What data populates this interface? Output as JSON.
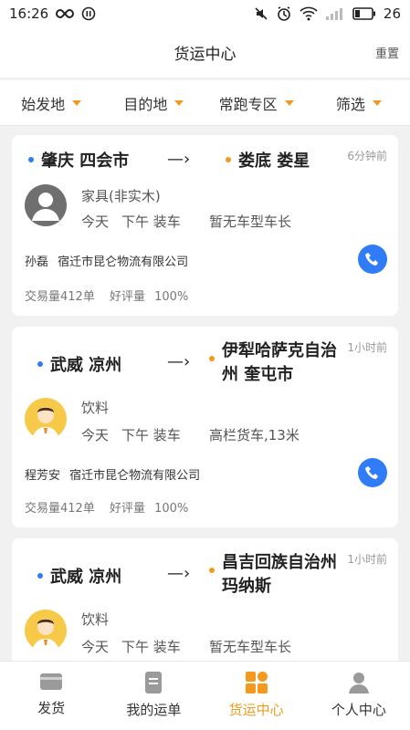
{
  "status_bar": {
    "time": "16:26",
    "battery": "26"
  },
  "header": {
    "title": "货运中心",
    "reset_label": "重置"
  },
  "filters": [
    {
      "label": "始发地"
    },
    {
      "label": "目的地"
    },
    {
      "label": "常跑专区"
    },
    {
      "label": "筛选"
    }
  ],
  "colors": {
    "accent": "#f39a1e",
    "blue": "#2f7cf6"
  },
  "cards": [
    {
      "from": "肇庆 四会市",
      "to": "娄底 娄星",
      "time_ago": "6分钟前",
      "goods": "家具(非实木)",
      "day": "今天",
      "period": "下午 装车",
      "truck": "暂无车型车长",
      "contact": "孙磊",
      "company": "宿迁市昆仑物流有限公司",
      "trades": "交易量412单",
      "rating_label": "好评量",
      "rating": "100%",
      "avatar": "default-avatar-icon"
    },
    {
      "from": "武威 凉州",
      "to": "伊犁哈萨克自治州 奎屯市",
      "time_ago": "1小时前",
      "goods": "饮料",
      "day": "今天",
      "period": "下午 装车",
      "truck": "高栏货车,13米",
      "contact": "程芳安",
      "company": "宿迁市昆仑物流有限公司",
      "trades": "交易量412单",
      "rating_label": "好评量",
      "rating": "100%",
      "avatar": "person-avatar-icon"
    },
    {
      "from": "武威 凉州",
      "to": "昌吉回族自治州 玛纳斯",
      "time_ago": "1小时前",
      "goods": "饮料",
      "day": "今天",
      "period": "下午 装车",
      "truck": "暂无车型车长",
      "avatar": "person-avatar-icon"
    }
  ],
  "tabs": [
    {
      "label": "发货",
      "icon": "wallet-icon",
      "active": false
    },
    {
      "label": "我的运单",
      "icon": "document-icon",
      "active": false
    },
    {
      "label": "货运中心",
      "icon": "grid-icon",
      "active": true
    },
    {
      "label": "个人中心",
      "icon": "person-icon",
      "active": false
    }
  ]
}
